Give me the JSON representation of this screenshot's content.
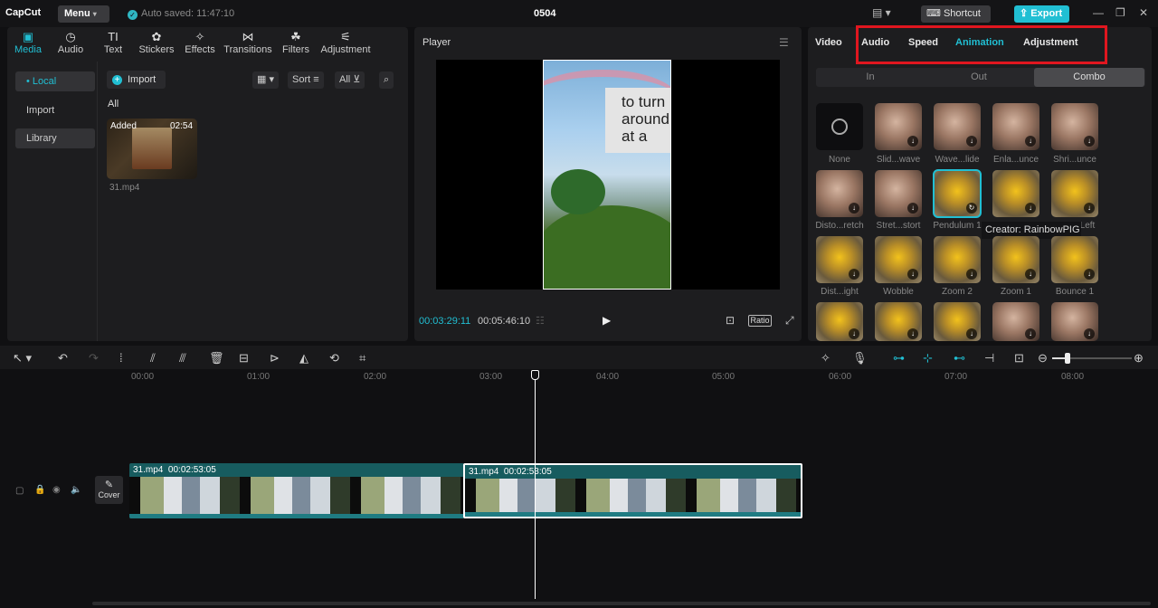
{
  "topbar": {
    "logo": "CapCut",
    "menu_label": "Menu",
    "autosave": "Auto saved: 11:47:10",
    "project_name": "0504",
    "shortcut_label": "Shortcut",
    "export_label": "Export"
  },
  "tool_tabs": [
    {
      "label": "Media",
      "icon": "▣"
    },
    {
      "label": "Audio",
      "icon": "◷"
    },
    {
      "label": "Text",
      "icon": "TI"
    },
    {
      "label": "Stickers",
      "icon": "✿"
    },
    {
      "label": "Effects",
      "icon": "✧"
    },
    {
      "label": "Transitions",
      "icon": "⋈"
    },
    {
      "label": "Filters",
      "icon": "☘"
    },
    {
      "label": "Adjustment",
      "icon": "⚟"
    }
  ],
  "sidebar": {
    "local": "• Local",
    "import": "Import",
    "library": "Library"
  },
  "media": {
    "import_label": "Import",
    "sort_label": "Sort",
    "all_filter": "All",
    "all_heading": "All",
    "item": {
      "badge": "Added",
      "duration": "02:54",
      "name": "31.mp4"
    }
  },
  "player": {
    "title": "Player",
    "current_time": "00:03:29:11",
    "total_time": "00:05:46:10",
    "ratio_label": "Ratio",
    "overlay_text": "to turn around at a"
  },
  "props": {
    "tabs": [
      "Video",
      "Audio",
      "Speed",
      "Animation",
      "Adjustment"
    ],
    "active_tab": "Animation",
    "segments": [
      "In",
      "Out",
      "Combo"
    ],
    "active_segment": "Combo",
    "animations": [
      [
        "None",
        "Slid...wave",
        "Wave...lide",
        "Enla...unce",
        "Shri...unce"
      ],
      [
        "Disto...retch",
        "Stret...stort",
        "Pendulum 1",
        "",
        "Left"
      ],
      [
        "Dist...ight",
        "Wobble",
        "Zoom 2",
        "Zoom 1",
        "Bounce 1"
      ],
      [
        "",
        "",
        "",
        "",
        ""
      ]
    ],
    "tooltip": "Creator: RainbowPIG"
  },
  "timeline": {
    "ticks": [
      "00:00",
      "01:00",
      "02:00",
      "03:00",
      "04:00",
      "05:00",
      "06:00",
      "07:00",
      "08:00"
    ],
    "cover_label": "Cover",
    "clips": [
      {
        "name": "31.mp4",
        "duration": "00:02:53:05"
      },
      {
        "name": "31.mp4",
        "duration": "00:02:53:05"
      }
    ]
  },
  "colors": {
    "accent": "#21bfd3",
    "highlight": "#e0161f",
    "clip": "#175c5f"
  }
}
